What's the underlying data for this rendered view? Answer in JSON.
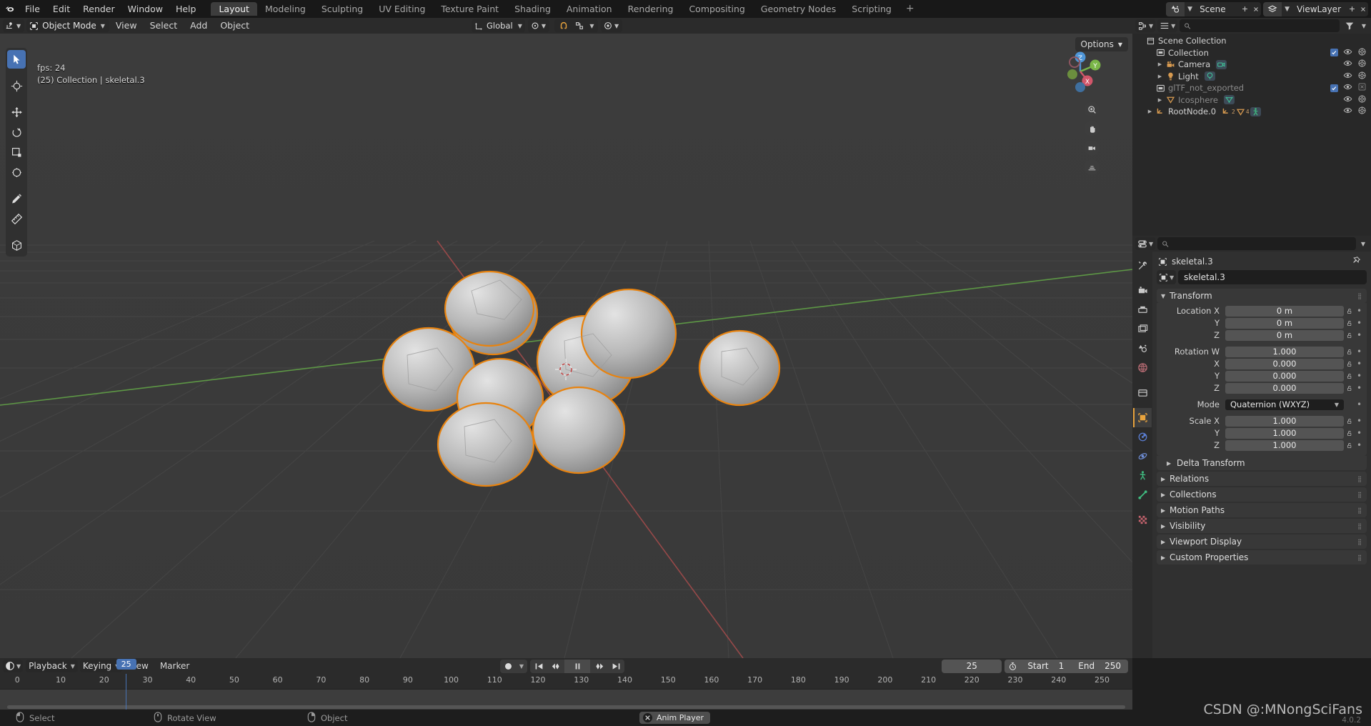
{
  "app": {
    "version": "4.0.2",
    "watermark": "CSDN @:MNongSciFans"
  },
  "topbar": {
    "menus": [
      "File",
      "Edit",
      "Render",
      "Window",
      "Help"
    ],
    "workspace_tabs": [
      {
        "label": "Layout",
        "active": true
      },
      {
        "label": "Modeling",
        "active": false
      },
      {
        "label": "Sculpting",
        "active": false
      },
      {
        "label": "UV Editing",
        "active": false
      },
      {
        "label": "Texture Paint",
        "active": false
      },
      {
        "label": "Shading",
        "active": false
      },
      {
        "label": "Animation",
        "active": false
      },
      {
        "label": "Rendering",
        "active": false
      },
      {
        "label": "Compositing",
        "active": false
      },
      {
        "label": "Geometry Nodes",
        "active": false
      },
      {
        "label": "Scripting",
        "active": false
      }
    ],
    "add_workspace": "+",
    "scene_name": "Scene",
    "viewlayer_name": "ViewLayer"
  },
  "viewport_header": {
    "mode": "Object Mode",
    "menus": [
      "View",
      "Select",
      "Add",
      "Object"
    ],
    "orientation": "Global",
    "options_label": "Options"
  },
  "viewport": {
    "fps_text": "fps: 24",
    "status_text": "(25) Collection | skeletal.3",
    "gizmo_axes": [
      "Z",
      "Y",
      "X"
    ]
  },
  "outliner": {
    "search_placeholder": "",
    "rows": [
      {
        "label": "Scene Collection",
        "icon": "scene-collection-icon",
        "indent": 0,
        "disclosure": false,
        "dim": false,
        "checkbox": false,
        "eye": false,
        "camera": false
      },
      {
        "label": "Collection",
        "icon": "collection-icon",
        "indent": 1,
        "disclosure": false,
        "dim": false,
        "checkbox": true,
        "eye": true,
        "camera": true
      },
      {
        "label": "Camera",
        "icon": "camera-obj-icon",
        "indent": 2,
        "disclosure": true,
        "dim": false,
        "checkbox": false,
        "eye": true,
        "camera": true,
        "badge": "camera-data-icon"
      },
      {
        "label": "Light",
        "icon": "light-obj-icon",
        "indent": 2,
        "disclosure": true,
        "dim": false,
        "checkbox": false,
        "eye": true,
        "camera": true,
        "badge": "light-data-icon"
      },
      {
        "label": "glTF_not_exported",
        "icon": "collection-icon",
        "indent": 1,
        "disclosure": false,
        "dim": true,
        "checkbox": true,
        "eye": true,
        "camera": "disabled"
      },
      {
        "label": "Icosphere",
        "icon": "mesh-icon",
        "indent": 2,
        "disclosure": true,
        "dim": true,
        "checkbox": false,
        "eye": true,
        "camera": true,
        "badge": "mesh-data-icon"
      },
      {
        "label": "RootNode.0",
        "icon": "empty-axis-icon",
        "indent": 1,
        "disclosure": true,
        "dim": false,
        "checkbox": false,
        "eye": true,
        "camera": true,
        "badge": "multi"
      }
    ],
    "rootnode_counts": {
      "empty": "2",
      "mesh": "4"
    }
  },
  "properties": {
    "breadcrumb_object": "skeletal.3",
    "object_name_field": "skeletal.3",
    "transform": {
      "title": "Transform",
      "fields": [
        {
          "label": "Location X",
          "value": "0 m"
        },
        {
          "label": "Y",
          "value": "0 m"
        },
        {
          "label": "Z",
          "value": "0 m"
        }
      ],
      "rotation": [
        {
          "label": "Rotation W",
          "value": "1.000"
        },
        {
          "label": "X",
          "value": "0.000"
        },
        {
          "label": "Y",
          "value": "0.000"
        },
        {
          "label": "Z",
          "value": "0.000"
        }
      ],
      "mode_label": "Mode",
      "mode_value": "Quaternion (WXYZ)",
      "scale": [
        {
          "label": "Scale X",
          "value": "1.000"
        },
        {
          "label": "Y",
          "value": "1.000"
        },
        {
          "label": "Z",
          "value": "1.000"
        }
      ],
      "delta_transform": "Delta Transform"
    },
    "collapsed_panels": [
      "Relations",
      "Collections",
      "Motion Paths",
      "Visibility",
      "Viewport Display",
      "Custom Properties"
    ]
  },
  "timeline": {
    "menus_dropdowns": [
      "Playback",
      "Keying"
    ],
    "menus": [
      "View",
      "Marker"
    ],
    "current_frame": "25",
    "start_label": "Start",
    "start_value": "1",
    "end_label": "End",
    "end_value": "250",
    "ruler_ticks": [
      "0",
      "10",
      "20",
      "25",
      "30",
      "40",
      "50",
      "60",
      "70",
      "80",
      "90",
      "100",
      "110",
      "120",
      "130",
      "140",
      "150",
      "160",
      "170",
      "180",
      "190",
      "200",
      "210",
      "220",
      "230",
      "240",
      "250"
    ]
  },
  "statusbar": {
    "items": [
      {
        "label": "Select",
        "icon": "mouse-left-icon"
      },
      {
        "label": "Rotate View",
        "icon": "mouse-middle-icon"
      },
      {
        "label": "Object",
        "icon": "mouse-right-icon"
      }
    ],
    "anim_player": "Anim Player"
  }
}
